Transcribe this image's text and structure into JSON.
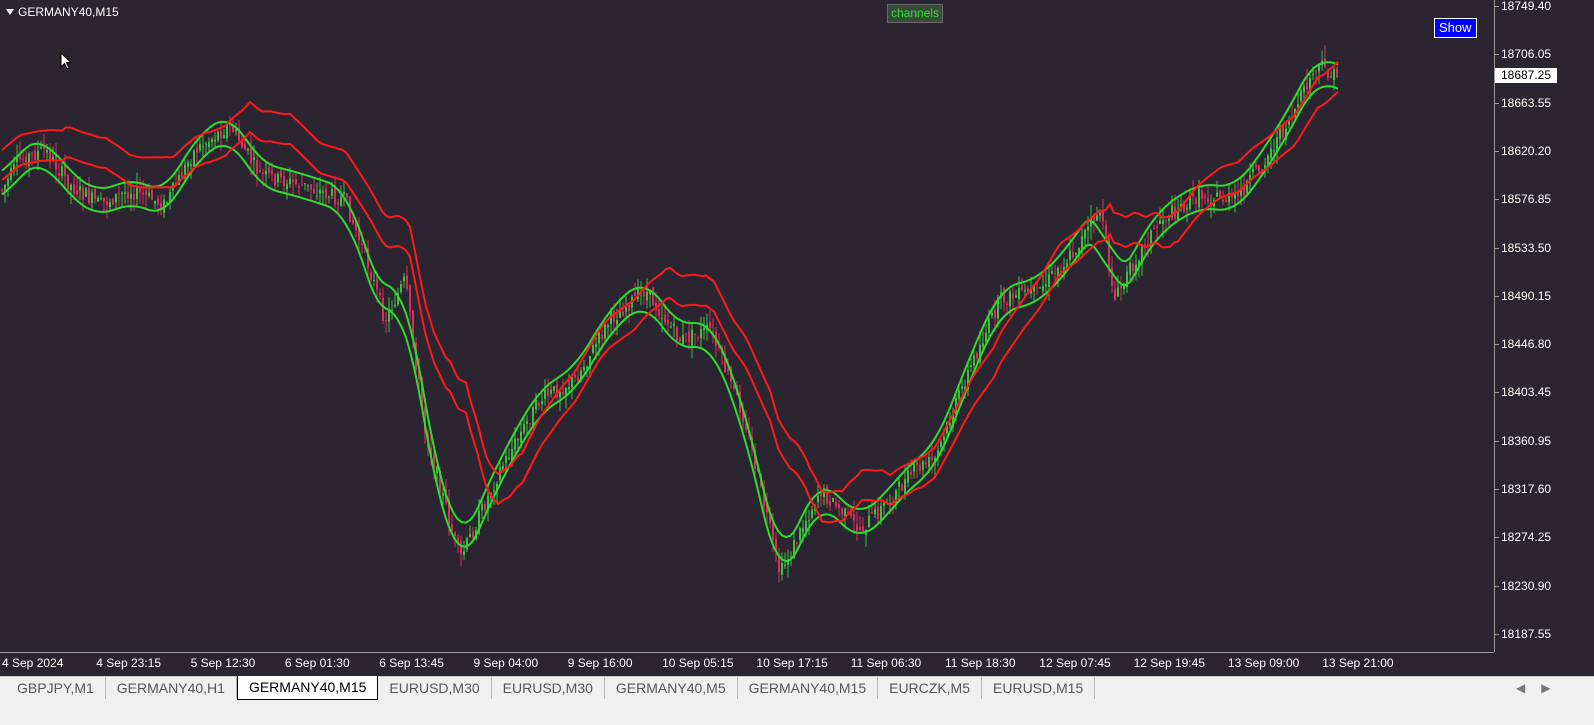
{
  "window": {
    "symbol": "GERMANY40,M15"
  },
  "indicator": {
    "label": "channels"
  },
  "controls": {
    "show_label": "Show"
  },
  "price_axis": {
    "ticks": [
      "18749.40",
      "18706.05",
      "18663.55",
      "18620.20",
      "18576.85",
      "18533.50",
      "18490.15",
      "18446.80",
      "18403.45",
      "18360.95",
      "18317.60",
      "18274.25",
      "18230.90",
      "18187.55"
    ],
    "current_price": "18687.25"
  },
  "time_axis": {
    "labels": [
      "4 Sep 2024",
      "4 Sep 23:15",
      "5 Sep 12:30",
      "6 Sep 01:30",
      "6 Sep 13:45",
      "9 Sep 04:00",
      "9 Sep 16:00",
      "10 Sep 05:15",
      "10 Sep 17:15",
      "11 Sep 06:30",
      "11 Sep 18:30",
      "12 Sep 07:45",
      "12 Sep 19:45",
      "13 Sep 09:00",
      "13 Sep 21:00"
    ]
  },
  "colors": {
    "background": "#2a2530",
    "bull_candle": "#3fbf3f",
    "bear_candle": "#d6305a",
    "ma_line": "#2edc2e",
    "channel_line": "#ff1a1a"
  },
  "tabs": [
    {
      "label": "GBPJPY,M1"
    },
    {
      "label": "GERMANY40,H1"
    },
    {
      "label": "GERMANY40,M15",
      "active": true
    },
    {
      "label": "EURUSD,M30"
    },
    {
      "label": "EURUSD,M30"
    },
    {
      "label": "GERMANY40,M5"
    },
    {
      "label": "GERMANY40,M15"
    },
    {
      "label": "EURCZK,M5"
    },
    {
      "label": "EURUSD,M15"
    }
  ],
  "tab_scroll": {
    "left_icon": "chevron-left-icon",
    "right_icon": "chevron-right-icon",
    "left_glyph": "◀",
    "right_glyph": "▶"
  }
}
